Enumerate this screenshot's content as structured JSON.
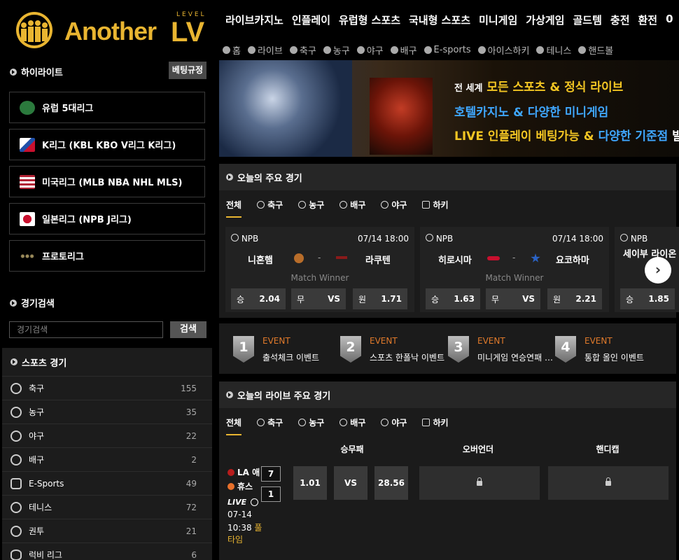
{
  "brand": {
    "name": "Another",
    "lv": "LV",
    "level": "LEVEL"
  },
  "top_nav": [
    "라이브카지노",
    "인플레이",
    "유럽형 스포츠",
    "국내형 스포츠",
    "미니게임",
    "가상게임",
    "골드템",
    "충전",
    "환전",
    "0"
  ],
  "sub_nav": [
    {
      "label": "홈",
      "icon": "home-icon"
    },
    {
      "label": "라이브",
      "icon": "play-icon"
    },
    {
      "label": "축구",
      "icon": "soccer-icon"
    },
    {
      "label": "농구",
      "icon": "basketball-icon"
    },
    {
      "label": "야구",
      "icon": "baseball-icon"
    },
    {
      "label": "배구",
      "icon": "volleyball-icon"
    },
    {
      "label": "E-sports",
      "icon": "gamepad-icon"
    },
    {
      "label": "아이스하키",
      "icon": "hockey-icon"
    },
    {
      "label": "테니스",
      "icon": "tennis-icon"
    },
    {
      "label": "핸드볼",
      "icon": "handball-icon"
    }
  ],
  "sidebar": {
    "highlight_title": "하이라이트",
    "rules_button": "베팅규정",
    "leagues": [
      {
        "label": "유럽 5대리그",
        "color": "#2b7a3d"
      },
      {
        "label": "K리그 (KBL KBO V리그 K리그)",
        "color": "#1f4fa8"
      },
      {
        "label": "미국리그 (MLB NBA NHL MLS)",
        "color": "#b22234"
      },
      {
        "label": "일본리그 (NPB J리그)",
        "color": "#c8102e"
      },
      {
        "label": "프로토리그",
        "color": "#7a6a3a"
      }
    ],
    "search_title": "경기검색",
    "search_placeholder": "경기검색",
    "search_button": "검색",
    "sports_title": "스포츠 경기",
    "sports": [
      {
        "name": "축구",
        "count": "155"
      },
      {
        "name": "농구",
        "count": "35"
      },
      {
        "name": "야구",
        "count": "22"
      },
      {
        "name": "배구",
        "count": "2"
      },
      {
        "name": "E-Sports",
        "count": "49"
      },
      {
        "name": "테니스",
        "count": "72"
      },
      {
        "name": "권투",
        "count": "21"
      },
      {
        "name": "럭비 리그",
        "count": "6"
      }
    ]
  },
  "banner": {
    "line1a": "전 세계",
    "line1b": "모든 스포츠 & 정식 라이브",
    "line2": "호텔카지노 & 다양한 미니게임",
    "line3a": "LIVE 인플레이 베팅가능 &",
    "line3b": "다양한 기준점",
    "line3c": "발매"
  },
  "today": {
    "title": "오늘의 주요 경기",
    "tabs": [
      "전체",
      "축구",
      "농구",
      "배구",
      "야구",
      "하키"
    ],
    "match_label": "Match Winner",
    "cards": [
      {
        "league": "NPB",
        "time": "07/14 18:00",
        "home": "니혼햄",
        "away": "라쿠텐",
        "odds": [
          [
            "승",
            "2.04"
          ],
          [
            "무",
            "VS"
          ],
          [
            "원",
            "1.71"
          ]
        ]
      },
      {
        "league": "NPB",
        "time": "07/14 18:00",
        "home": "히로시마",
        "away": "요코하마",
        "odds": [
          [
            "승",
            "1.63"
          ],
          [
            "무",
            "VS"
          ],
          [
            "원",
            "2.21"
          ]
        ]
      },
      {
        "league": "NPB",
        "time": "",
        "home": "세이부 라이온",
        "away": "",
        "odds": [
          [
            "승",
            "1.85"
          ]
        ]
      }
    ]
  },
  "events": [
    {
      "num": "1",
      "tag": "EVENT",
      "desc": "출석체크 이벤트"
    },
    {
      "num": "2",
      "tag": "EVENT",
      "desc": "스포츠 한폴낙 이벤트"
    },
    {
      "num": "3",
      "tag": "EVENT",
      "desc": "미니게임 연승연패 이벤트"
    },
    {
      "num": "4",
      "tag": "EVENT",
      "desc": "통합 올인 이벤트"
    }
  ],
  "live": {
    "title": "오늘의 라이브 주요 경기",
    "tabs": [
      "전체",
      "축구",
      "농구",
      "배구",
      "야구",
      "하키"
    ],
    "columns": [
      "승무패",
      "오버언더",
      "핸디캡"
    ],
    "match": {
      "home": "LA 애",
      "away": "휴스",
      "home_score": "7",
      "away_score": "1",
      "status": "LIVE",
      "date": "07-14",
      "time": "10:38",
      "period": "풀타임",
      "odds_home": "1.01",
      "odds_draw": "VS",
      "odds_away": "28.56"
    }
  }
}
